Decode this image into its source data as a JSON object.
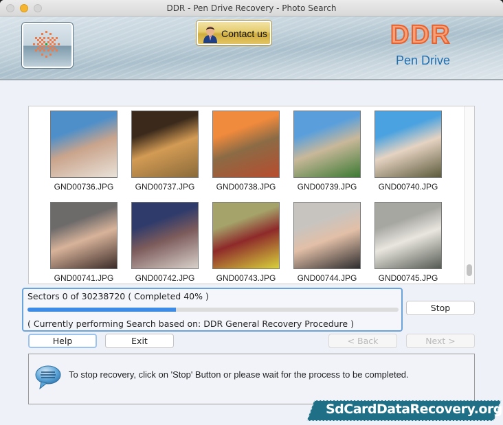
{
  "window": {
    "title": "DDR - Pen Drive Recovery - Photo Search"
  },
  "header": {
    "contact_label": "Contact us",
    "brand_main": "DDR",
    "brand_sub": "Pen Drive"
  },
  "photos": [
    {
      "name": "GND00736.JPG",
      "colors": [
        "#4f8fc9",
        "#e9e2d9",
        "#caa48c"
      ]
    },
    {
      "name": "GND00737.JPG",
      "colors": [
        "#3b2a1b",
        "#8a6a3a",
        "#d39b54"
      ]
    },
    {
      "name": "GND00738.JPG",
      "colors": [
        "#f08a3c",
        "#b84c2e",
        "#8b6b45"
      ]
    },
    {
      "name": "GND00739.JPG",
      "colors": [
        "#5a9fdc",
        "#3c7a33",
        "#c9b89a"
      ]
    },
    {
      "name": "GND00740.JPG",
      "colors": [
        "#4aa2e0",
        "#5c5a3c",
        "#e6d3c2"
      ]
    },
    {
      "name": "GND00741.JPG",
      "colors": [
        "#6d6a6a",
        "#3b2b28",
        "#d8b39a"
      ]
    },
    {
      "name": "GND00742.JPG",
      "colors": [
        "#2f3b6b",
        "#d9d1cb",
        "#7c5b5b"
      ]
    },
    {
      "name": "GND00743.JPG",
      "colors": [
        "#a5a36a",
        "#d8d23b",
        "#8e2a2a"
      ]
    },
    {
      "name": "GND00744.JPG",
      "colors": [
        "#c7c4c0",
        "#2d2c2e",
        "#e2bfa7"
      ]
    },
    {
      "name": "GND00745.JPG",
      "colors": [
        "#a7a7a2",
        "#545a52",
        "#e9e6df"
      ]
    }
  ],
  "progress": {
    "sectors_text": "Sectors  0 of 30238720    ( Completed 40% )",
    "percent": 40,
    "procedure_text": "( Currently performing Search based on: DDR General Recovery Procedure )"
  },
  "buttons": {
    "stop": "Stop",
    "help": "Help",
    "exit": "Exit",
    "back": "< Back",
    "next": "Next >"
  },
  "info": {
    "message": "To stop recovery, click on 'Stop' Button or please wait for the process to be completed."
  },
  "watermark": {
    "text": "SdCardDataRecovery.org"
  }
}
